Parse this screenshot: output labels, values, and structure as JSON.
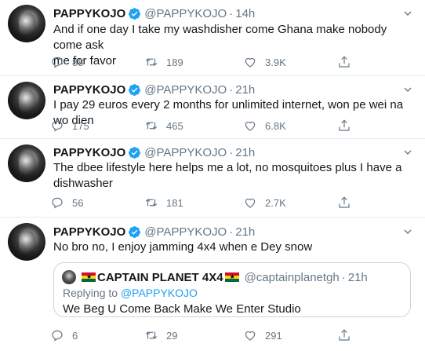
{
  "colors": {
    "accent": "#1da1f2",
    "text": "#14171a",
    "muted": "#657786",
    "border": "#e6ecf0"
  },
  "tweets": [
    {
      "name": "PAPPYKOJO",
      "handle": "@PAPPYKOJO",
      "time": "14h",
      "text_lines": [
        "And if one day I take my washdisher come Ghana make nobody come ask",
        "me for favor"
      ],
      "replies": "88",
      "retweets": "189",
      "likes": "3.9K"
    },
    {
      "name": "PAPPYKOJO",
      "handle": "@PAPPYKOJO",
      "time": "21h",
      "text_lines": [
        "I pay 29 euros every 2 months for unlimited internet, won pe wei na wo dien"
      ],
      "replies": "175",
      "retweets": "465",
      "likes": "6.8K"
    },
    {
      "name": "PAPPYKOJO",
      "handle": "@PAPPYKOJO",
      "time": "21h",
      "text_lines": [
        "The dbee lifestyle here helps me a lot, no mosquitoes  plus I have a",
        "dishwasher"
      ],
      "replies": "56",
      "retweets": "181",
      "likes": "2.7K"
    },
    {
      "name": "PAPPYKOJO",
      "handle": "@PAPPYKOJO",
      "time": "21h",
      "text_lines": [
        "No bro no, I enjoy jamming 4x4 when e Dey snow"
      ],
      "replies": "6",
      "retweets": "29",
      "likes": "291",
      "quote": {
        "name": "CAPTAIN PLANET 4X4",
        "handle": "@captainplanetgh",
        "time": "21h",
        "replying_prefix": "Replying to ",
        "replying_to": "@PAPPYKOJO",
        "text": "We Beg U Come Back Make We Enter Studio"
      }
    }
  ],
  "separator": "·",
  "icons": [
    "verified-badge-icon",
    "chevron-down-icon",
    "reply-icon",
    "retweet-icon",
    "like-icon",
    "share-icon",
    "ghana-flag-icon"
  ]
}
